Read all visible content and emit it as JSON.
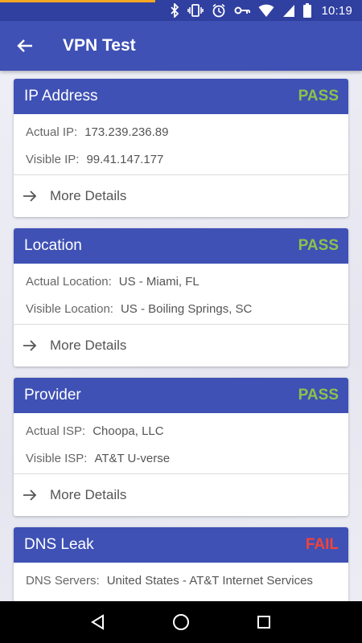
{
  "status_bar": {
    "time": "10:19",
    "icons": [
      "bluetooth-icon",
      "vibrate-icon",
      "alarm-icon",
      "vpn-key-icon",
      "wifi-icon",
      "signal-icon",
      "battery-icon"
    ],
    "progress": 0.43
  },
  "app_bar": {
    "title": "VPN Test",
    "back_icon": "arrow-back-icon",
    "color": "#3f51b5"
  },
  "cards": [
    {
      "title": "IP Address",
      "status": "PASS",
      "rows": [
        {
          "label": "Actual IP:",
          "value": "173.239.236.89"
        },
        {
          "label": "Visible IP:",
          "value": "99.41.147.177"
        }
      ],
      "more_details": "More Details"
    },
    {
      "title": "Location",
      "status": "PASS",
      "rows": [
        {
          "label": "Actual Location:",
          "value": "US - Miami, FL"
        },
        {
          "label": "Visible Location:",
          "value": "US - Boiling Springs, SC"
        }
      ],
      "more_details": "More Details"
    },
    {
      "title": "Provider",
      "status": "PASS",
      "rows": [
        {
          "label": "Actual ISP:",
          "value": "Choopa, LLC"
        },
        {
          "label": "Visible ISP:",
          "value": "AT&T U-verse"
        }
      ],
      "more_details": "More Details"
    },
    {
      "title": "DNS Leak",
      "status": "FAIL",
      "rows": [
        {
          "label": "DNS Servers:",
          "value": "United States - AT&T Internet Services"
        }
      ]
    }
  ],
  "colors": {
    "pass": "#8bc34a",
    "fail": "#f44336",
    "header": "#3f51b5"
  },
  "nav_bar": {
    "buttons": [
      "back-triangle-icon",
      "home-circle-icon",
      "recents-square-icon"
    ]
  }
}
